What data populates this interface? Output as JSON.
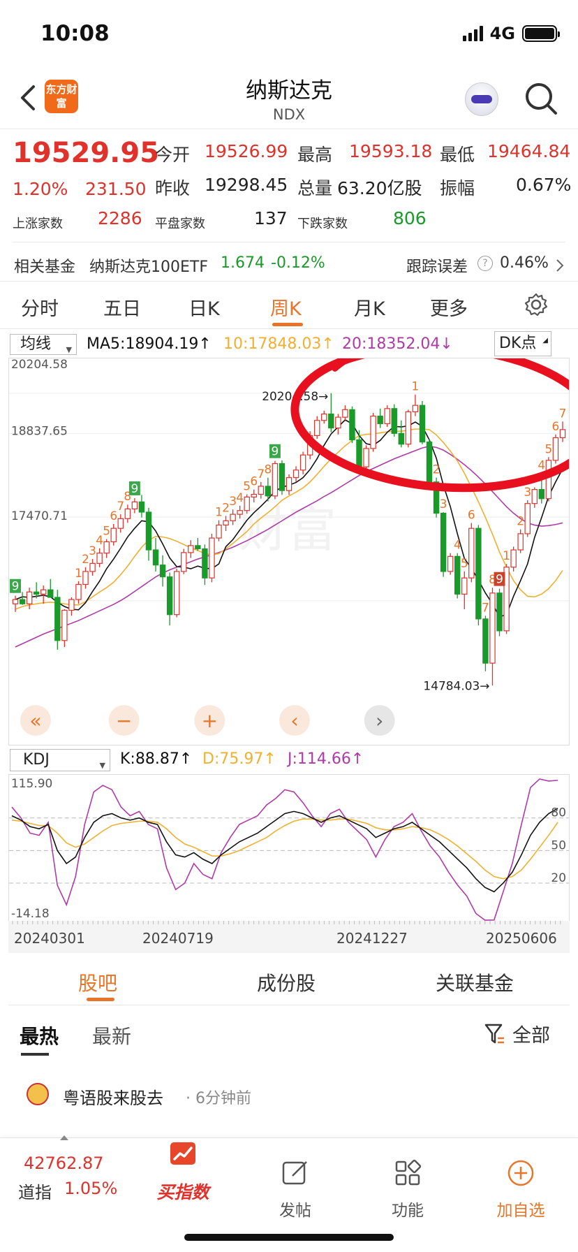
{
  "status": {
    "time": "10:08",
    "network": "4G"
  },
  "nav": {
    "logo": "东方财富",
    "title": "纳斯达克",
    "code": "NDX"
  },
  "quote": {
    "price": "19529.95",
    "change_pct": "1.20%",
    "change": "231.50",
    "open_label": "今开",
    "open": "19526.99",
    "high_label": "最高",
    "high": "19593.18",
    "low_label": "最低",
    "low": "19464.84",
    "prev_label": "昨收",
    "prev": "19298.45",
    "vol_label": "总量",
    "vol": "63.20亿股",
    "amp_label": "振幅",
    "amp": "0.67%",
    "up_label": "上涨家数",
    "up": "2286",
    "flat_label": "平盘家数",
    "flat": "137",
    "down_label": "下跌家数",
    "down": "806"
  },
  "fund": {
    "label": "相关基金",
    "name": "纳斯达克100ETF",
    "price": "1.674",
    "change": "-0.12%",
    "err_label": "跟踪误差",
    "err": "0.46%"
  },
  "tabs": [
    "分时",
    "五日",
    "日K",
    "周K",
    "月K",
    "更多"
  ],
  "ma": {
    "select": "均线",
    "ma5": "MA5:18904.19↑",
    "ma10": "10:17848.03↑",
    "ma20": "20:18352.04↓",
    "dk": "DK点"
  },
  "chart_data": {
    "type": "candlestick",
    "y_labels": [
      "20204.58",
      "18837.65",
      "17470.71"
    ],
    "ylim": [
      14784.03,
      20204.58
    ],
    "max_label": "20204.58→",
    "min_label": "14784.03→",
    "candles": [
      [
        16300,
        16450,
        16150,
        16380
      ],
      [
        16380,
        16520,
        16280,
        16300
      ],
      [
        16300,
        16600,
        16200,
        16520
      ],
      [
        16520,
        16700,
        16400,
        16480
      ],
      [
        16480,
        16640,
        16300,
        16560
      ],
      [
        16560,
        16760,
        16420,
        16420
      ],
      [
        16420,
        16560,
        15450,
        15620
      ],
      [
        15620,
        16200,
        15500,
        16180
      ],
      [
        16180,
        16420,
        16080,
        16380
      ],
      [
        16380,
        16720,
        16300,
        16660
      ],
      [
        16660,
        16980,
        16580,
        16900
      ],
      [
        16900,
        17130,
        16820,
        17050
      ],
      [
        17050,
        17330,
        16980,
        17240
      ],
      [
        17240,
        17500,
        17150,
        17450
      ],
      [
        17450,
        17780,
        17380,
        17700
      ],
      [
        17700,
        17960,
        17620,
        17880
      ],
      [
        17880,
        18140,
        17800,
        18060
      ],
      [
        18060,
        18260,
        17980,
        18190
      ],
      [
        18190,
        18320,
        17900,
        18000
      ],
      [
        18000,
        18080,
        17100,
        17300
      ],
      [
        17300,
        17520,
        16900,
        17020
      ],
      [
        17020,
        17200,
        16620,
        16800
      ],
      [
        16800,
        16880,
        15900,
        16100
      ],
      [
        16100,
        16950,
        16050,
        16900
      ],
      [
        16900,
        17320,
        16850,
        17250
      ],
      [
        17250,
        17480,
        17150,
        17380
      ],
      [
        17380,
        17520,
        17280,
        17320
      ],
      [
        17320,
        17400,
        16650,
        16780
      ],
      [
        16780,
        17600,
        16700,
        17520
      ],
      [
        17520,
        17850,
        17460,
        17760
      ],
      [
        17760,
        17930,
        17650,
        17840
      ],
      [
        17840,
        18050,
        17760,
        17960
      ],
      [
        17960,
        18120,
        17880,
        18030
      ],
      [
        18030,
        18330,
        17970,
        18280
      ],
      [
        18280,
        18420,
        18180,
        18330
      ],
      [
        18330,
        18560,
        18250,
        18480
      ],
      [
        18480,
        18640,
        18200,
        18300
      ],
      [
        18300,
        18950,
        18240,
        18900
      ],
      [
        18900,
        18960,
        18320,
        18400
      ],
      [
        18400,
        18700,
        18320,
        18640
      ],
      [
        18640,
        18850,
        18560,
        18780
      ],
      [
        18780,
        19120,
        18700,
        19060
      ],
      [
        19060,
        19500,
        18980,
        19420
      ],
      [
        19420,
        19780,
        19360,
        19700
      ],
      [
        19700,
        19880,
        19640,
        19820
      ],
      [
        19820,
        20204.58,
        19480,
        19560
      ],
      [
        19560,
        19820,
        19440,
        19760
      ],
      [
        19760,
        19980,
        19700,
        19900
      ],
      [
        19900,
        19960,
        19280,
        19340
      ],
      [
        19340,
        19520,
        18760,
        18840
      ],
      [
        18840,
        19240,
        18800,
        19180
      ],
      [
        19180,
        19840,
        19120,
        19780
      ],
      [
        19780,
        19920,
        19560,
        19640
      ],
      [
        19640,
        19980,
        19580,
        19920
      ],
      [
        19920,
        20000,
        19400,
        19460
      ],
      [
        19460,
        19700,
        19200,
        19260
      ],
      [
        19260,
        19900,
        19200,
        19860
      ],
      [
        19860,
        20180,
        19780,
        19980
      ],
      [
        19980,
        20060,
        19260,
        19300
      ],
      [
        19300,
        19360,
        18500,
        18560
      ],
      [
        18560,
        18640,
        17900,
        17980
      ],
      [
        17980,
        18000,
        16800,
        16900
      ],
      [
        16900,
        17240,
        16840,
        17180
      ],
      [
        17180,
        17240,
        16400,
        16480
      ],
      [
        16480,
        16900,
        16200,
        16780
      ],
      [
        16780,
        17800,
        16700,
        17700
      ],
      [
        17700,
        17760,
        15900,
        16020
      ],
      [
        16020,
        16080,
        15050,
        15200
      ],
      [
        15200,
        16600,
        14784.03,
        16500
      ],
      [
        16500,
        16580,
        15700,
        15800
      ],
      [
        15800,
        17040,
        15740,
        16980
      ],
      [
        16980,
        17360,
        16900,
        17300
      ],
      [
        17300,
        17680,
        17240,
        17600
      ],
      [
        17600,
        18220,
        17540,
        18160
      ],
      [
        18160,
        18460,
        18080,
        18420
      ],
      [
        18420,
        18720,
        18160,
        18250
      ],
      [
        18250,
        19020,
        18200,
        18960
      ],
      [
        18960,
        19440,
        18900,
        19380
      ],
      [
        19380,
        19680,
        19300,
        19529.95
      ]
    ],
    "ma5": [
      16380,
      16430,
      16420,
      16440,
      16460,
      16430,
      16330,
      16250,
      16200,
      16190,
      16320,
      16530,
      16720,
      16950,
      17130,
      17330,
      17540,
      17700,
      17840,
      17820,
      17650,
      17410,
      17150,
      16990,
      16980,
      16950,
      17000,
      16960,
      16950,
      17040,
      17360,
      17490,
      17670,
      17850,
      17990,
      18110,
      18240,
      18390,
      18460,
      18500,
      18550,
      18640,
      18790,
      18990,
      19240,
      19450,
      19580,
      19710,
      19640,
      19420,
      19270,
      19240,
      19330,
      19480,
      19590,
      19580,
      19600,
      19670,
      19590,
      19340,
      19000,
      18500,
      18100,
      17600,
      17140,
      16960,
      16740,
      16500,
      16300,
      16060,
      16100,
      16440,
      16730,
      17040,
      17530,
      17900,
      18290,
      18560,
      18800
    ],
    "ma10": [
      16200,
      16250,
      16280,
      16300,
      16320,
      16330,
      16320,
      16300,
      16280,
      16280,
      16340,
      16430,
      16520,
      16600,
      16700,
      16840,
      17000,
      17180,
      17350,
      17480,
      17550,
      17540,
      17510,
      17460,
      17400,
      17340,
      17290,
      17230,
      17210,
      17230,
      17320,
      17420,
      17530,
      17640,
      17780,
      17890,
      17990,
      18100,
      18220,
      18300,
      18370,
      18450,
      18560,
      18700,
      18850,
      18990,
      19110,
      19230,
      19330,
      19420,
      19440,
      19450,
      19470,
      19490,
      19500,
      19500,
      19520,
      19540,
      19540,
      19530,
      19430,
      19290,
      19130,
      18950,
      18720,
      18460,
      18190,
      17900,
      17590,
      17260,
      16980,
      16730,
      16560,
      16440,
      16430,
      16480,
      16580,
      16730,
      16920
    ],
    "ma20": [
      15500,
      15560,
      15620,
      15680,
      15740,
      15790,
      15840,
      15890,
      15940,
      15990,
      16050,
      16110,
      16170,
      16230,
      16290,
      16360,
      16440,
      16530,
      16620,
      16710,
      16800,
      16870,
      16930,
      16980,
      17030,
      17080,
      17130,
      17170,
      17210,
      17250,
      17300,
      17350,
      17410,
      17470,
      17540,
      17610,
      17680,
      17760,
      17840,
      17920,
      18000,
      18070,
      18140,
      18210,
      18290,
      18360,
      18440,
      18520,
      18600,
      18680,
      18750,
      18810,
      18870,
      18930,
      18990,
      19040,
      19090,
      19140,
      19190,
      19220,
      19200,
      19150,
      19070,
      18980,
      18880,
      18770,
      18650,
      18520,
      18380,
      18240,
      18100,
      17980,
      17880,
      17800,
      17760,
      17740,
      17750,
      17770,
      17800
    ],
    "seq_markers": [
      {
        "i": 0,
        "n": "9",
        "type": "green"
      },
      {
        "i": 9,
        "n": "1",
        "type": "red"
      },
      {
        "i": 10,
        "n": "2",
        "type": "red"
      },
      {
        "i": 11,
        "n": "3",
        "type": "red"
      },
      {
        "i": 12,
        "n": "4",
        "type": "red"
      },
      {
        "i": 13,
        "n": "5",
        "type": "red"
      },
      {
        "i": 14,
        "n": "6",
        "type": "red"
      },
      {
        "i": 15,
        "n": "7",
        "type": "red"
      },
      {
        "i": 16,
        "n": "8",
        "type": "red"
      },
      {
        "i": 17,
        "n": "9",
        "type": "green"
      },
      {
        "i": 29,
        "n": "1",
        "type": "red"
      },
      {
        "i": 30,
        "n": "2",
        "type": "red"
      },
      {
        "i": 31,
        "n": "3",
        "type": "red"
      },
      {
        "i": 32,
        "n": "4",
        "type": "red"
      },
      {
        "i": 33,
        "n": "5",
        "type": "red"
      },
      {
        "i": 34,
        "n": "6",
        "type": "red"
      },
      {
        "i": 35,
        "n": "7",
        "type": "red"
      },
      {
        "i": 36,
        "n": "8",
        "type": "red"
      },
      {
        "i": 37,
        "n": "9",
        "type": "green"
      },
      {
        "i": 57,
        "n": "1",
        "type": "red"
      },
      {
        "i": 60,
        "n": "2",
        "type": "red"
      },
      {
        "i": 61,
        "n": "3",
        "type": "red"
      },
      {
        "i": 63,
        "n": "4",
        "type": "red"
      },
      {
        "i": 64,
        "n": "5",
        "type": "red"
      },
      {
        "i": 65,
        "n": "6",
        "type": "red"
      },
      {
        "i": 67,
        "n": "7",
        "type": "red"
      },
      {
        "i": 68,
        "n": "8",
        "type": "red"
      },
      {
        "i": 69,
        "n": "9",
        "type": "dark"
      },
      {
        "i": 70,
        "n": "1",
        "type": "red"
      },
      {
        "i": 72,
        "n": "2",
        "type": "red"
      },
      {
        "i": 73,
        "n": "3",
        "type": "red"
      },
      {
        "i": 75,
        "n": "4",
        "type": "red"
      },
      {
        "i": 76,
        "n": "5",
        "type": "red"
      },
      {
        "i": 77,
        "n": "6",
        "type": "red"
      },
      {
        "i": 78,
        "n": "7",
        "type": "red"
      }
    ],
    "controls": [
      "«",
      "−",
      "+",
      "‹",
      "›"
    ]
  },
  "kdj": {
    "select": "KDJ",
    "k": "K:88.87↑",
    "d": "D:75.97↑",
    "j": "J:114.66↑",
    "y_top": "115.90",
    "y_bottom": "-14.18",
    "levels": [
      "80",
      "50",
      "20"
    ],
    "ylim": [
      -14.18,
      115.9
    ],
    "dates": [
      "20240301",
      "20240719",
      "20241227",
      "20250606"
    ],
    "k_values": [
      82,
      78,
      72,
      70,
      74,
      50,
      38,
      44,
      62,
      76,
      82,
      84,
      80,
      78,
      80,
      76,
      74,
      58,
      46,
      44,
      48,
      42,
      38,
      46,
      52,
      58,
      62,
      66,
      72,
      78,
      84,
      86,
      84,
      80,
      76,
      80,
      82,
      78,
      74,
      70,
      62,
      66,
      70,
      72,
      76,
      70,
      64,
      58,
      50,
      42,
      34,
      24,
      16,
      12,
      20,
      30,
      46,
      64,
      76,
      84,
      88.87
    ],
    "d_values": [
      78,
      77,
      75,
      73,
      73,
      66,
      57,
      53,
      56,
      62,
      68,
      73,
      75,
      76,
      77,
      77,
      76,
      70,
      62,
      56,
      53,
      49,
      45,
      45,
      47,
      50,
      54,
      58,
      62,
      68,
      73,
      77,
      79,
      79,
      78,
      78,
      79,
      79,
      77,
      75,
      71,
      69,
      69,
      70,
      72,
      71,
      69,
      65,
      60,
      54,
      47,
      40,
      32,
      26,
      24,
      26,
      32,
      42,
      53,
      64,
      75.97
    ],
    "j_values": [
      90,
      80,
      66,
      64,
      76,
      18,
      0,
      26,
      74,
      104,
      110,
      106,
      90,
      82,
      86,
      74,
      70,
      34,
      14,
      20,
      38,
      28,
      24,
      48,
      62,
      74,
      78,
      82,
      92,
      98,
      106,
      104,
      94,
      82,
      72,
      84,
      88,
      76,
      68,
      60,
      44,
      60,
      72,
      76,
      84,
      68,
      54,
      44,
      30,
      18,
      8,
      -8,
      -14.18,
      -14,
      12,
      38,
      74,
      108,
      115.9,
      114,
      114.66
    ]
  },
  "sections": {
    "tabs": [
      "股吧",
      "成份股",
      "关联基金"
    ],
    "sort": [
      "最热",
      "最新"
    ],
    "filter": "全部"
  },
  "post": {
    "user": "粤语股来股去",
    "time": "6分钟前"
  },
  "bottom": {
    "dji_price": "42762.87",
    "dji_name": "道指",
    "dji_change": "1.05%",
    "items": [
      "买指数",
      "发帖",
      "功能",
      "加自选"
    ]
  },
  "colors": {
    "up": "#e0322b",
    "down": "#1a9a2a",
    "accent": "#e8752a",
    "ma5": "#111111",
    "ma10": "#f0b030",
    "ma20": "#b03aa8"
  }
}
